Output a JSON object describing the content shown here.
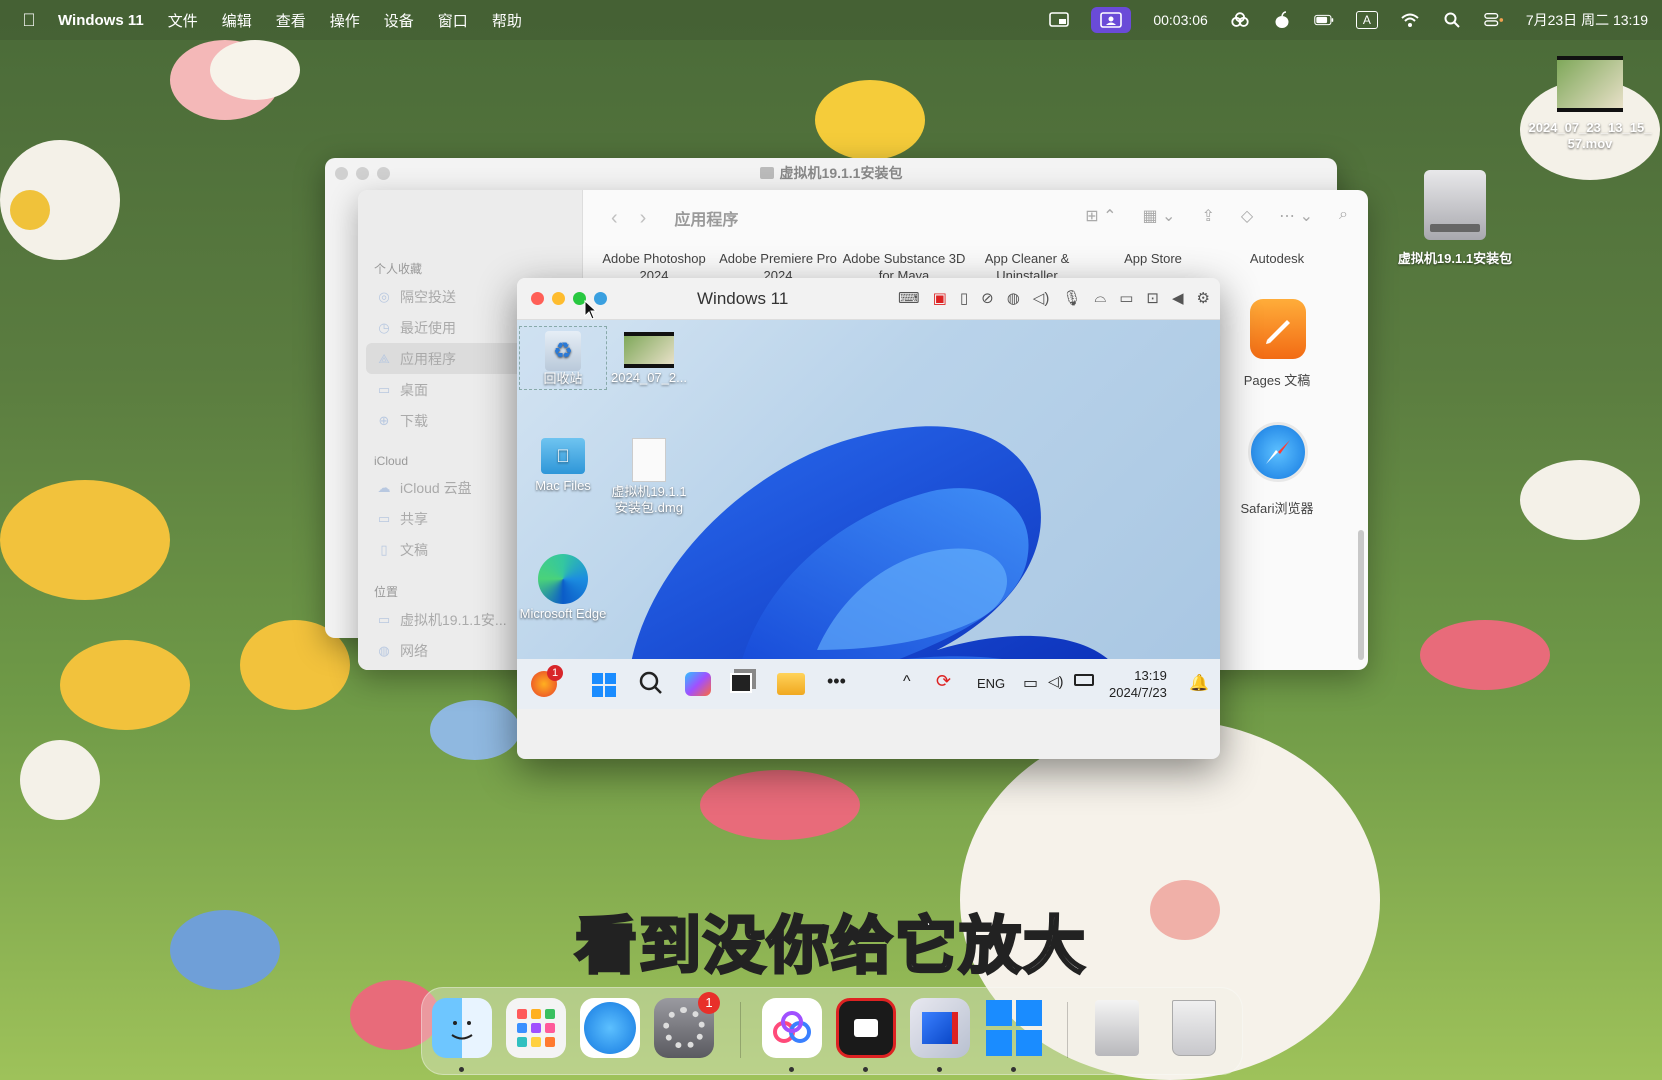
{
  "menubar": {
    "app_name": "Windows 11",
    "menus": [
      "文件",
      "编辑",
      "查看",
      "操作",
      "设备",
      "窗口",
      "帮助"
    ],
    "timer": "00:03:06",
    "datetime": "7月23日 周二 13:19",
    "input_indicator": "A"
  },
  "desktop": {
    "video_file_label": "2024_07_23_13_15_57.mov",
    "disk_label": "虚拟机19.1.1安装包"
  },
  "back_window": {
    "title": "虚拟机19.1.1安装包"
  },
  "finder": {
    "title": "应用程序",
    "sidebar": {
      "favorites_header": "个人收藏",
      "favorites": [
        "隔空投送",
        "最近使用",
        "应用程序",
        "桌面",
        "下载"
      ],
      "icloud_header": "iCloud",
      "icloud": [
        "iCloud 云盘",
        "共享",
        "文稿"
      ],
      "locations_header": "位置",
      "locations": [
        "虚拟机19.1.1安...",
        "网络"
      ]
    },
    "apps_row1": [
      "Adobe Photoshop 2024",
      "Adobe Premiere Pro 2024",
      "Adobe Substance 3D for Maya",
      "App Cleaner & Uninstaller",
      "App Store",
      "Autodesk"
    ],
    "pages_label": "Pages 文稿",
    "safari_label": "Safari浏览器"
  },
  "vm": {
    "title": "Windows 11",
    "icons": {
      "recycle": "回收站",
      "video": "2024_07_2...",
      "mac_files": "Mac Files",
      "dmg": "虚拟机19.1.1安装包.dmg",
      "edge": "Microsoft Edge"
    },
    "taskbar": {
      "badge": "1",
      "lang": "ENG",
      "time": "13:19",
      "date": "2024/7/23"
    }
  },
  "subtitle": "看到没你给它放大",
  "dock": {
    "settings_badge": "1"
  }
}
